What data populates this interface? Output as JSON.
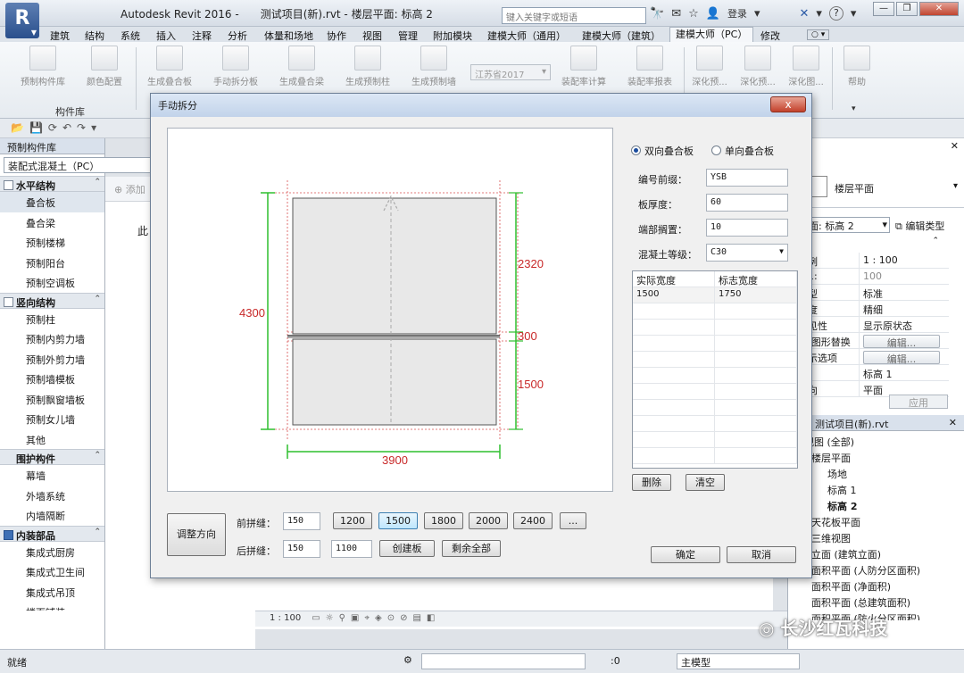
{
  "app": {
    "logo_letter": "R",
    "title": "Autodesk Revit 2016 -",
    "doc_title": "测试项目(新).rvt - 楼层平面: 标高 2",
    "search_placeholder": "键入关键字或短语",
    "login": "登录",
    "help_icon": "?"
  },
  "ribbon_tabs": [
    "建筑",
    "结构",
    "系统",
    "插入",
    "注释",
    "分析",
    "体量和场地",
    "协作",
    "视图",
    "管理",
    "附加模块",
    "建模大师（通用）",
    "建模大师（建筑）",
    "建模大师（PC）",
    "修改"
  ],
  "ribbon_buttons": [
    "预制构件库",
    "颜色配置",
    "生成叠合板",
    "手动拆分板",
    "生成叠合梁",
    "生成预制柱",
    "生成预制墙",
    "装配率计算",
    "装配率报表",
    "深化预...",
    "深化预...",
    "深化图...",
    "帮助"
  ],
  "ribbon_province": "江苏省2017",
  "panel_label": "构件库",
  "left_panel": {
    "title": "预制构件库",
    "selector": "装配式混凝土（PC）",
    "categories": [
      {
        "name": "水平结构",
        "items": [
          "叠合板",
          "叠合梁",
          "预制楼梯",
          "预制阳台",
          "预制空调板"
        ]
      },
      {
        "name": "竖向结构",
        "items": [
          "预制柱",
          "预制内剪力墙",
          "预制外剪力墙",
          "预制墙模板",
          "预制飘窗墙板",
          "预制女儿墙",
          "其他"
        ]
      },
      {
        "name": "围护构件",
        "items": [
          "幕墙",
          "外墙系统",
          "内墙隔断"
        ]
      },
      {
        "name": "内装部品",
        "items": [
          "集成式厨房",
          "集成式卫生间",
          "集成式吊顶",
          "楼面铺装"
        ]
      }
    ],
    "add_label": "添加",
    "cut_text": "此"
  },
  "dialog": {
    "title": "手动拆分",
    "close_icon": "x",
    "radio_two_way": "双向叠合板",
    "radio_one_way": "单向叠合板",
    "label_prefix": "编号前缀：",
    "value_prefix": "YSB",
    "label_thickness": "板厚度：",
    "value_thickness": "60",
    "label_end": "端部搁置：",
    "value_end": "10",
    "label_concrete": "混凝土等级：",
    "value_concrete": "C30",
    "table_headers": [
      "实际宽度",
      "标志宽度"
    ],
    "table_rows": [
      [
        "1500",
        "1750"
      ]
    ],
    "btn_delete": "删除",
    "btn_clear": "清空",
    "btn_direction": "调整方向",
    "label_front": "前拼缝：",
    "value_front": "150",
    "label_back": "后拼缝：",
    "value_back": "150",
    "value_back2": "1100",
    "sizes": [
      "1200",
      "1500",
      "1800",
      "2000",
      "2400",
      "..."
    ],
    "btn_create": "创建板",
    "btn_rest": "剩余全部",
    "btn_ok": "确定",
    "btn_cancel": "取消",
    "dims": {
      "total_height": "4300",
      "top": "2320",
      "mid": "300",
      "bottom": "1500",
      "width": "3900"
    }
  },
  "properties": {
    "type_name": "楼层平面",
    "level_select": "面: 标高 2",
    "edit_type": "编辑类型",
    "rows": [
      [
        "例",
        "1 : 100"
      ],
      [
        "1:",
        "100"
      ],
      [
        "型",
        "标准"
      ],
      [
        "度",
        "精细"
      ],
      [
        "见性",
        "显示原状态"
      ],
      [
        "/图形替换",
        "编辑..."
      ],
      [
        "示选项",
        "编辑..."
      ],
      [
        "",
        "标高 1"
      ],
      [
        "向",
        "平面"
      ]
    ],
    "apply": "应用"
  },
  "browser": {
    "title": "器 - 测试项目(新).rvt",
    "items": [
      "视图 (全部)",
      "楼层平面",
      "场地",
      "标高 1",
      "标高 2",
      "天花板平面",
      "三维视图",
      "立面 (建筑立面)",
      "面积平面 (人防分区面积)",
      "面积平面 (净面积)",
      "面积平面 (总建筑面积)",
      "面积平面 (防火分区面积)"
    ]
  },
  "view_scale": "1 : 100",
  "status": {
    "ready": "就绪",
    "zero": ":0",
    "model": "主模型"
  },
  "watermark": "长沙红瓦科技"
}
